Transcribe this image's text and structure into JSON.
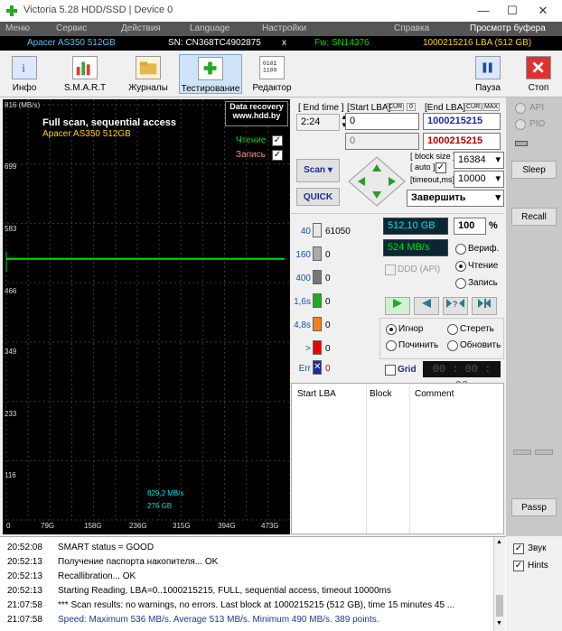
{
  "window": {
    "title": "Victoria 5.28 HDD/SSD | Device 0",
    "min": "—",
    "max": "☐",
    "close": "✕"
  },
  "menu": [
    "Меню",
    "Сервис",
    "Действия",
    "Language",
    "Настройки",
    "Справка",
    "Просмотр буфера"
  ],
  "info": {
    "model": "Apacer AS350 512GB",
    "sn": "SN: CN368TC4902875",
    "x": "x",
    "fw": "Fw: SN14376",
    "lba": "1000215216 LBA (512 GB)"
  },
  "toolbar": {
    "info": "Инфо",
    "smart": "S.M.A.R.T",
    "logs": "Журналы",
    "test": "Тестирование",
    "editor": "Редактор",
    "pause": "Пауза",
    "stop": "Стоп"
  },
  "graph": {
    "ymax": "816 (MB/s)",
    "title": "Full scan, sequential access",
    "device": "Apacer AS350 512GB",
    "recovery1": "Data recovery",
    "recovery2": "www.hdd.by",
    "read": "Чтение",
    "write": "Запись",
    "yticks": [
      "699",
      "583",
      "466",
      "349",
      "233",
      "116"
    ],
    "xticks": [
      "0",
      "79G",
      "158G",
      "236G",
      "315G",
      "394G",
      "473G"
    ],
    "speed": "829,2 MB/s",
    "pos": "276 GB"
  },
  "graph_data": {
    "speed_mbps": 513,
    "max_mbps": 816
  },
  "controls": {
    "end_time_lbl": "[ End time ]",
    "end_time": "2:24",
    "start_lba_lbl": "[Start LBA]",
    "cur": "CUR",
    "cur_val": "0",
    "end_lba_lbl": "[End LBA]",
    "cur2": "CUR",
    "max": "MAX",
    "start_lba": "0",
    "end_lba": "1000215215",
    "start_lba2": "0",
    "end_lba2": "1000215215",
    "scan": "Scan",
    "quick": "QUICK",
    "block_size_lbl": "[ block size ]",
    "auto": "[ auto ]",
    "block_size": "16384",
    "timeout_lbl": "[timeout,ms]",
    "timeout": "10000",
    "finish": "Завершить"
  },
  "blocks": {
    "labels": [
      "40",
      "160",
      "400",
      "1,6s",
      "4,8s",
      ">",
      "Err"
    ],
    "counts": [
      "61050",
      "0",
      "0",
      "0",
      "0",
      "0",
      "0"
    ]
  },
  "stats": {
    "gb": "512,10 GB",
    "pct": "100",
    "pct_sign": "%",
    "speed": "524 MB/s",
    "verify": "Вериф.",
    "read": "Чтение",
    "write": "Запись",
    "ddd": "DDD (API)"
  },
  "mode": {
    "ignore": "Игнор",
    "erase": "Стереть",
    "repair": "Починить",
    "refresh": "Обновить",
    "grid": "Grid",
    "timer": "00 : 00 : 00"
  },
  "table": {
    "start": "Start LBA",
    "block": "Block",
    "comment": "Comment"
  },
  "side": {
    "api": "API",
    "pio": "PIO",
    "sleep": "Sleep",
    "recall": "Recall",
    "passp": "Passp",
    "sound": "Звук",
    "hints": "Hints"
  },
  "log": [
    {
      "t": "20:52:08",
      "m": "SMART status = GOOD"
    },
    {
      "t": "20:52:13",
      "m": "Получение паспорта накопителя... OK"
    },
    {
      "t": "20:52:13",
      "m": "Recallibration... OK"
    },
    {
      "t": "20:52:13",
      "m": "Starting Reading, LBA=0..1000215215, FULL, sequential access, timeout 10000ms"
    },
    {
      "t": "21:07:58",
      "m": "*** Scan results: no warnings, no errors. Last block at 1000215215 (512 GB), time 15 minutes 45 ..."
    },
    {
      "t": "21:07:58",
      "m": "Speed: Maximum 536 MB/s. Average 513 MB/s. Minimum 490 MB/s. 389 points."
    }
  ],
  "colors": {
    "accent": "#1a73e8",
    "green": "#00cc00",
    "cyan": "#00e0e0",
    "red": "#c00000"
  }
}
